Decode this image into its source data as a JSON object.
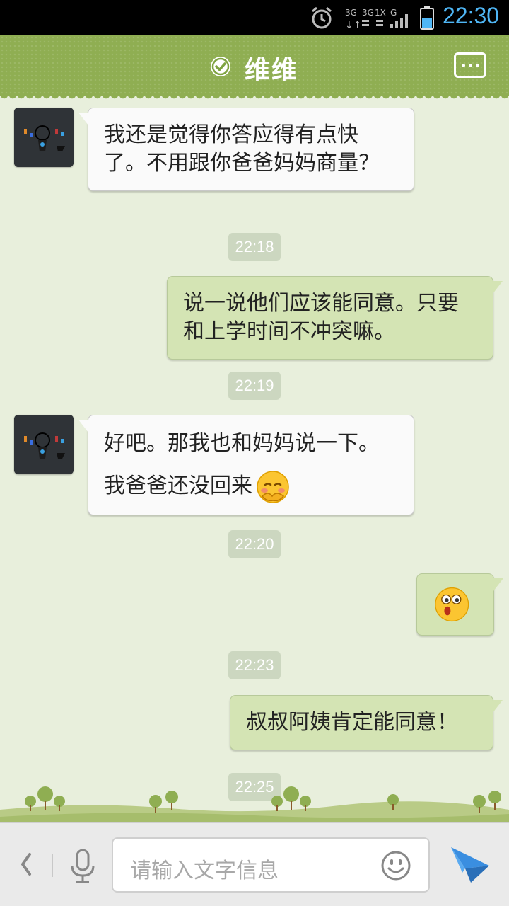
{
  "status_bar": {
    "time": "22:30",
    "network": "3G 3G 1X G"
  },
  "header": {
    "title": "维维"
  },
  "messages": [
    {
      "side": "in",
      "text": "我还是觉得你答应得有点快了。不用跟你爸爸妈妈商量？"
    },
    {
      "type": "time",
      "text": "22:18"
    },
    {
      "side": "out",
      "text": "说一说他们应该能同意。只要和上学时间不冲突嘛。"
    },
    {
      "type": "time",
      "text": "22:19"
    },
    {
      "side": "in",
      "text": "好吧。那我也和妈妈说一下。我爸爸还没回来",
      "emoji": "shy-face-emoji"
    },
    {
      "type": "time",
      "text": "22:20"
    },
    {
      "side": "out",
      "emoji": "surprised-face-emoji"
    },
    {
      "type": "time",
      "text": "22:23"
    },
    {
      "side": "out",
      "text": "叔叔阿姨肯定能同意！"
    },
    {
      "type": "time",
      "text": "22:25"
    }
  ],
  "input": {
    "placeholder": "请输入文字信息"
  },
  "colors": {
    "header": "#8fae52",
    "background": "#e8efdc",
    "outgoing_bubble": "#d4e4b4",
    "incoming_bubble": "#fafafa",
    "time_accent": "#4fb6f5",
    "send": "#3a8ee0"
  }
}
